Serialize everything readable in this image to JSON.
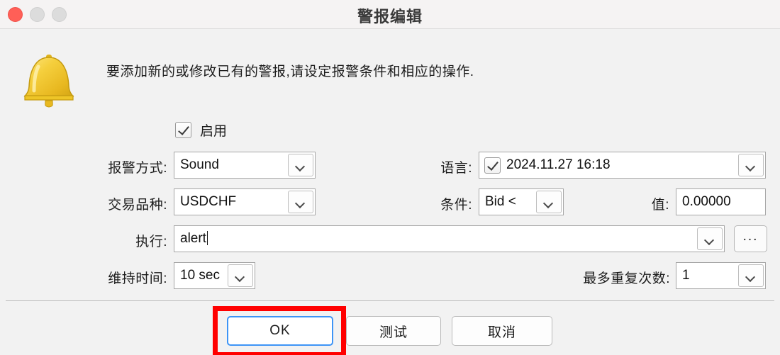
{
  "window": {
    "title": "警报编辑",
    "traffic_lights": [
      "close",
      "minimize",
      "maximize"
    ]
  },
  "header": {
    "icon": "bell-icon",
    "description": "要添加新的或修改已有的警报,请设定报警条件和相应的操作."
  },
  "form": {
    "enable": {
      "label": "启用",
      "checked": true
    },
    "alert_type": {
      "label": "报警方式:",
      "value": "Sound"
    },
    "expiration": {
      "label": "语言:",
      "checked": true,
      "value": "2024.11.27 16:18"
    },
    "symbol": {
      "label": "交易品种:",
      "value": "USDCHF"
    },
    "condition": {
      "label": "条件:",
      "value": "Bid <"
    },
    "value_field": {
      "label": "值:",
      "value": "0.00000"
    },
    "source": {
      "label": "执行:",
      "value": "alert",
      "browse_label": "..."
    },
    "timeout": {
      "label": "维持时间:",
      "value": "10 sec"
    },
    "max_iterations": {
      "label": "最多重复次数:",
      "value": "1"
    }
  },
  "footer": {
    "ok_label": "OK",
    "test_label": "测试",
    "cancel_label": "取消"
  },
  "annotation": {
    "color": "#ff0000",
    "target": "ok-button"
  }
}
